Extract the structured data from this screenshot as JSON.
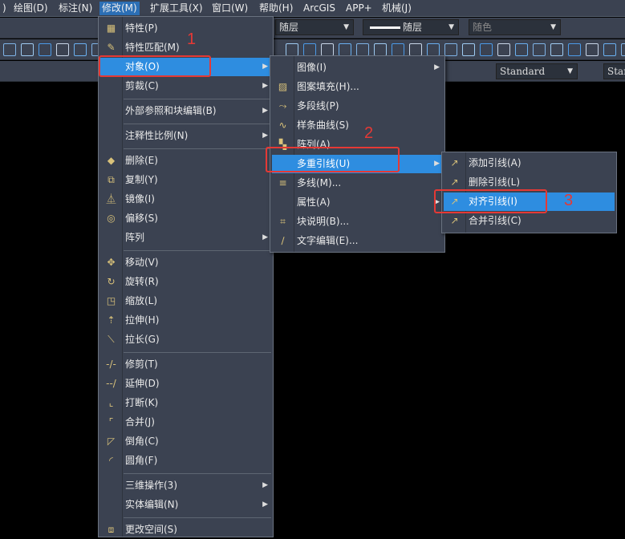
{
  "menubar": [
    ")",
    "绘图(D)",
    "标注(N)",
    "修改(M)",
    "扩展工具(X)",
    "窗口(W)",
    "帮助(H)",
    "ArcGIS",
    "APP+",
    "机械(J)"
  ],
  "toolbar": {
    "layer_combo": "随层",
    "linetype_combo": "随层",
    "color_combo": "随色",
    "dimstyle_combo": "Standard",
    "textstyle_combo": "Star"
  },
  "modify_menu": [
    {
      "label": "特性(P)",
      "icon": "properties-icon",
      "glyph": "▦"
    },
    {
      "label": "特性匹配(M)",
      "icon": "match-properties-icon",
      "glyph": "✎"
    },
    {
      "label": "对象(O)",
      "sub": true,
      "hl": true
    },
    {
      "label": "剪裁(C)",
      "sub": true
    },
    {
      "sep": true
    },
    {
      "label": "外部参照和块编辑(B)",
      "sub": true
    },
    {
      "sep": true
    },
    {
      "label": "注释性比例(N)",
      "sub": true
    },
    {
      "sep": true
    },
    {
      "label": "删除(E)",
      "icon": "erase-icon",
      "glyph": "◆"
    },
    {
      "label": "复制(Y)",
      "icon": "copy-icon",
      "glyph": "⧉"
    },
    {
      "label": "镜像(I)",
      "icon": "mirror-icon",
      "glyph": "⏅"
    },
    {
      "label": "偏移(S)",
      "icon": "offset-icon",
      "glyph": "◎"
    },
    {
      "label": "阵列",
      "sub": true
    },
    {
      "sep": true
    },
    {
      "label": "移动(V)",
      "icon": "move-icon",
      "glyph": "✥"
    },
    {
      "label": "旋转(R)",
      "icon": "rotate-icon",
      "glyph": "↻"
    },
    {
      "label": "缩放(L)",
      "icon": "scale-icon",
      "glyph": "◳"
    },
    {
      "label": "拉伸(H)",
      "icon": "stretch-icon",
      "glyph": "⇡"
    },
    {
      "label": "拉长(G)",
      "icon": "lengthen-icon",
      "glyph": "⟍"
    },
    {
      "sep": true
    },
    {
      "label": "修剪(T)",
      "icon": "trim-icon",
      "glyph": "-/-"
    },
    {
      "label": "延伸(D)",
      "icon": "extend-icon",
      "glyph": "--/"
    },
    {
      "label": "打断(K)",
      "icon": "break-icon",
      "glyph": "⌞"
    },
    {
      "label": "合并(J)",
      "icon": "join-icon",
      "glyph": "⌜"
    },
    {
      "label": "倒角(C)",
      "icon": "chamfer-icon",
      "glyph": "◸"
    },
    {
      "label": "圆角(F)",
      "icon": "fillet-icon",
      "glyph": "◜"
    },
    {
      "sep": true
    },
    {
      "label": "三维操作(3)",
      "sub": true
    },
    {
      "label": "实体编辑(N)",
      "sub": true
    },
    {
      "sep": true
    },
    {
      "label": "更改空间(S)",
      "icon": "change-space-icon",
      "glyph": "⧈"
    }
  ],
  "object_menu": [
    {
      "label": "图像(I)",
      "sub": true
    },
    {
      "label": "图案填充(H)...",
      "icon": "hatch-icon",
      "glyph": "▨"
    },
    {
      "label": "多段线(P)",
      "icon": "polyline-icon",
      "glyph": "⤳"
    },
    {
      "label": "样条曲线(S)",
      "icon": "spline-icon",
      "glyph": "∿"
    },
    {
      "label": "阵列(A)",
      "icon": "array-icon",
      "glyph": "▚"
    },
    {
      "label": "多重引线(U)",
      "sub": true,
      "hl": true
    },
    {
      "label": "多线(M)...",
      "icon": "multiline-icon",
      "glyph": "≡"
    },
    {
      "label": "属性(A)",
      "sub": true
    },
    {
      "label": "块说明(B)...",
      "icon": "block-description-icon",
      "glyph": "⌗"
    },
    {
      "label": "文字编辑(E)...",
      "icon": "text-edit-icon",
      "glyph": "∕"
    }
  ],
  "mleader_menu": [
    {
      "label": "添加引线(A)",
      "icon": "add-leader-icon",
      "glyph": "↗"
    },
    {
      "label": "删除引线(L)",
      "icon": "remove-leader-icon",
      "glyph": "↗"
    },
    {
      "label": "对齐引线(I)",
      "icon": "align-leader-icon",
      "glyph": "↗",
      "hl": true
    },
    {
      "label": "合并引线(C)",
      "icon": "collect-leader-icon",
      "glyph": "↗"
    }
  ],
  "annotations": [
    "1",
    "2",
    "3"
  ]
}
